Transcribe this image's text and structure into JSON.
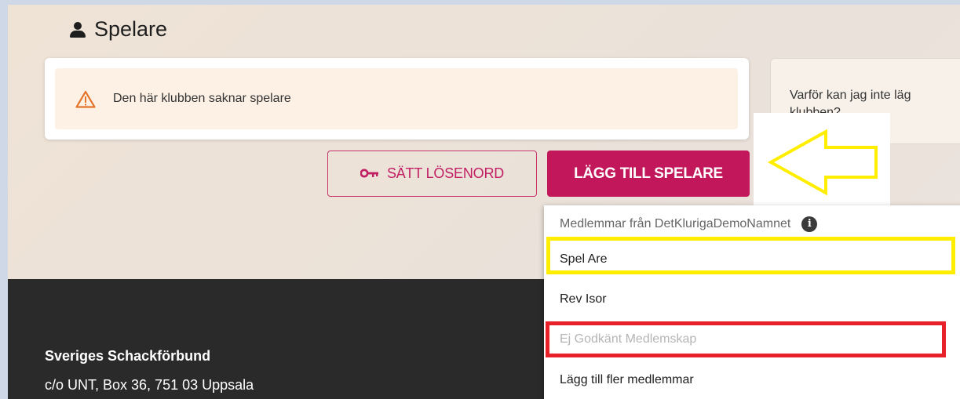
{
  "page": {
    "title": "Spelare",
    "title_icon": "person-icon"
  },
  "alert": {
    "icon": "warning-icon",
    "text": "Den här klubben saknar spelare"
  },
  "side_card": {
    "line1": "Varför kan jag inte läg",
    "line2": "klubben?"
  },
  "buttons": {
    "set_password": {
      "icon": "key-icon",
      "label": "SÄTT LÖSENORD"
    },
    "add_player": {
      "label": "LÄGG TILL SPELARE"
    }
  },
  "dropdown": {
    "header": "Medlemmar från DetKlurigaDemoNamnet",
    "header_icon": "info-icon",
    "items": [
      {
        "label": "Spel Are",
        "disabled": false
      },
      {
        "label": "Rev Isor",
        "disabled": false
      },
      {
        "label": "Ej Godkänt Medlemskap",
        "disabled": true
      },
      {
        "label": "Lägg till fler medlemmar",
        "disabled": false
      }
    ]
  },
  "footer": {
    "org": "Sveriges Schackförbund",
    "address": "c/o UNT, Box 36, 751 03 Uppsala"
  },
  "colors": {
    "accent": "#c2185b",
    "highlight_yellow": "#ffee00",
    "highlight_red": "#e8202a",
    "footer_bg": "#2a2a2a"
  }
}
